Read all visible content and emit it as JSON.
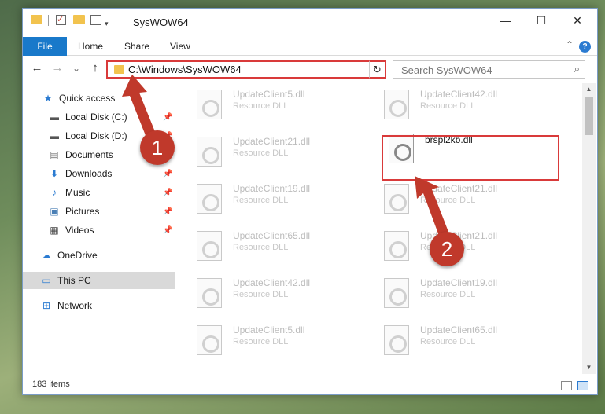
{
  "window": {
    "title": "SysWOW64",
    "controls": {
      "minimize": "—",
      "maximize": "☐",
      "close": "✕"
    }
  },
  "ribbon": {
    "tabs": [
      "File",
      "Home",
      "Share",
      "View"
    ],
    "help": "?"
  },
  "nav": {
    "back": "←",
    "forward": "→",
    "recent": "⌄",
    "up": "↑",
    "address": "C:\\Windows\\SysWOW64",
    "refresh": "↻",
    "search_placeholder": "Search SysWOW64"
  },
  "sidebar": {
    "items": [
      {
        "label": "Quick access",
        "icon": "star-icon",
        "pinned": false
      },
      {
        "label": "Local Disk (C:)",
        "icon": "drive-icon",
        "pinned": true
      },
      {
        "label": "Local Disk (D:)",
        "icon": "drive-icon",
        "pinned": true
      },
      {
        "label": "Documents",
        "icon": "documents-icon",
        "pinned": true
      },
      {
        "label": "Downloads",
        "icon": "downloads-icon",
        "pinned": true
      },
      {
        "label": "Music",
        "icon": "music-icon",
        "pinned": true
      },
      {
        "label": "Pictures",
        "icon": "pictures-icon",
        "pinned": true
      },
      {
        "label": "Videos",
        "icon": "videos-icon",
        "pinned": true
      },
      {
        "label": "OneDrive",
        "icon": "cloud-icon",
        "pinned": false
      },
      {
        "label": "This PC",
        "icon": "computer-icon",
        "pinned": false,
        "selected": true
      },
      {
        "label": "Network",
        "icon": "network-icon",
        "pinned": false
      }
    ]
  },
  "files": [
    {
      "name": "UpdateClient5.dll",
      "type": "Resource DLL"
    },
    {
      "name": "UpdateClient42.dll",
      "type": "Resource DLL"
    },
    {
      "name": "UpdateClient21.dll",
      "type": "Resource DLL"
    },
    {
      "name": "brspl2kb.dll",
      "type": "",
      "highlight": true
    },
    {
      "name": "UpdateClient19.dll",
      "type": "Resource DLL"
    },
    {
      "name": "UpdateClient21.dll",
      "type": "Resource DLL"
    },
    {
      "name": "UpdateClient65.dll",
      "type": "Resource DLL"
    },
    {
      "name": "UpdateClient21.dll",
      "type": "Resource DLL"
    },
    {
      "name": "UpdateClient42.dll",
      "type": "Resource DLL"
    },
    {
      "name": "UpdateClient19.dll",
      "type": "Resource DLL"
    },
    {
      "name": "UpdateClient5.dll",
      "type": "Resource DLL"
    },
    {
      "name": "UpdateClient65.dll",
      "type": "Resource DLL"
    }
  ],
  "status": {
    "items": "183 items"
  },
  "annotations": {
    "step1": "1",
    "step2": "2",
    "color": "#c0392b"
  }
}
